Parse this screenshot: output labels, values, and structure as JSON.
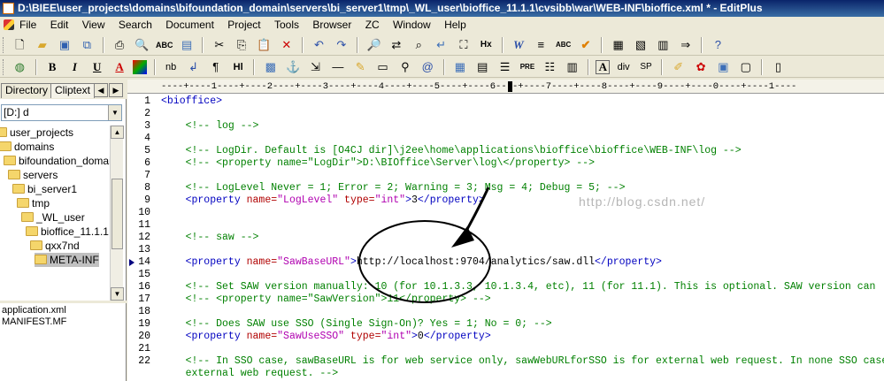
{
  "window": {
    "title": "D:\\BIEE\\user_projects\\domains\\bifoundation_domain\\servers\\bi_server1\\tmp\\_WL_user\\bioffice_11.1.1\\cvsibb\\war\\WEB-INF\\bioffice.xml * - EditPlus"
  },
  "menu": [
    "File",
    "Edit",
    "View",
    "Search",
    "Document",
    "Project",
    "Tools",
    "Browser",
    "ZC",
    "Window",
    "Help"
  ],
  "toolbar2_text": {
    "nb": "nb",
    "bold": "B",
    "italic": "I",
    "underline": "U",
    "font": "A",
    "para": "¶",
    "hi": "Hl",
    "pre": "PRE",
    "a": "A",
    "div": "div",
    "sp": "SP"
  },
  "left_panel": {
    "tabs": [
      "Directory",
      "Cliptext"
    ],
    "drive": "[D:] d",
    "tree": [
      {
        "label": "user_projects",
        "indent": 0
      },
      {
        "label": "domains",
        "indent": 1
      },
      {
        "label": "bifoundation_domain",
        "indent": 2
      },
      {
        "label": "servers",
        "indent": 3
      },
      {
        "label": "bi_server1",
        "indent": 4
      },
      {
        "label": "tmp",
        "indent": 5
      },
      {
        "label": "_WL_user",
        "indent": 6
      },
      {
        "label": "bioffice_11.1.1",
        "indent": 7
      },
      {
        "label": "qxx7nd",
        "indent": 8
      },
      {
        "label": "META-INF",
        "indent": 9,
        "selected": true
      }
    ],
    "files": [
      "application.xml",
      "MANIFEST.MF"
    ]
  },
  "editor": {
    "ruler": "----+----1----+----2----+----3----+----4----+----5----+----6----+----7----+----8----+----9----+----0----+----1----",
    "current_line": 14,
    "lines": [
      {
        "n": "1",
        "tokens": [
          {
            "t": "<bioffice>",
            "c": "tag"
          }
        ]
      },
      {
        "n": "2",
        "tokens": []
      },
      {
        "n": "3",
        "tokens": [
          {
            "t": "    <!-- log -->",
            "c": "cmt"
          }
        ]
      },
      {
        "n": "4",
        "tokens": []
      },
      {
        "n": "5",
        "tokens": [
          {
            "t": "    <!-- LogDir. Default is [O4CJ dir]\\j2ee\\home\\applications\\bioffice\\bioffice\\WEB-INF\\log -->",
            "c": "cmt"
          }
        ]
      },
      {
        "n": "6",
        "tokens": [
          {
            "t": "    <!-- <property name=\"LogDir\">D:\\BIOffice\\Server\\log\\</property> -->",
            "c": "cmt"
          }
        ]
      },
      {
        "n": "7",
        "tokens": []
      },
      {
        "n": "8",
        "tokens": [
          {
            "t": "    <!-- LogLevel Never = 1; Error = 2; Warning = 3; Msg = 4; Debug = 5; -->",
            "c": "cmt"
          }
        ]
      },
      {
        "n": "9",
        "tokens": [
          {
            "t": "    <property ",
            "c": "tag"
          },
          {
            "t": "name=",
            "c": "attr"
          },
          {
            "t": "\"LogLevel\"",
            "c": "str"
          },
          {
            "t": " type=",
            "c": "attr"
          },
          {
            "t": "\"int\"",
            "c": "str"
          },
          {
            "t": ">",
            "c": "tag"
          },
          {
            "t": "3",
            "c": "txt"
          },
          {
            "t": "</property>",
            "c": "tag"
          }
        ]
      },
      {
        "n": "10",
        "tokens": []
      },
      {
        "n": "11",
        "tokens": []
      },
      {
        "n": "12",
        "tokens": [
          {
            "t": "    <!-- saw -->",
            "c": "cmt"
          }
        ]
      },
      {
        "n": "13",
        "tokens": []
      },
      {
        "n": "14",
        "tokens": [
          {
            "t": "    <property ",
            "c": "tag"
          },
          {
            "t": "name=",
            "c": "attr"
          },
          {
            "t": "\"SawBaseURL\"",
            "c": "str"
          },
          {
            "t": ">",
            "c": "tag"
          },
          {
            "t": "http://localhost:9704/analytics/saw.dll",
            "c": "txt"
          },
          {
            "t": "</property>",
            "c": "tag"
          }
        ]
      },
      {
        "n": "15",
        "tokens": []
      },
      {
        "n": "16",
        "tokens": [
          {
            "t": "    <!-- Set SAW version manually: 10 (for 10.1.3.3, 10.1.3.4, etc), 11 (for 11.1). This is optional. SAW version can",
            "c": "cmt"
          }
        ]
      },
      {
        "n": "17",
        "tokens": [
          {
            "t": "    <!-- <property name=\"SawVersion\">11</property> -->",
            "c": "cmt"
          }
        ]
      },
      {
        "n": "18",
        "tokens": []
      },
      {
        "n": "19",
        "tokens": [
          {
            "t": "    <!-- Does SAW use SSO (Single Sign-On)? Yes = 1; No = 0; -->",
            "c": "cmt"
          }
        ]
      },
      {
        "n": "20",
        "tokens": [
          {
            "t": "    <property ",
            "c": "tag"
          },
          {
            "t": "name=",
            "c": "attr"
          },
          {
            "t": "\"SawUseSSO\"",
            "c": "str"
          },
          {
            "t": " type=",
            "c": "attr"
          },
          {
            "t": "\"int\"",
            "c": "str"
          },
          {
            "t": ">",
            "c": "tag"
          },
          {
            "t": "0",
            "c": "txt"
          },
          {
            "t": "</property>",
            "c": "tag"
          }
        ]
      },
      {
        "n": "21",
        "tokens": []
      },
      {
        "n": "22",
        "tokens": [
          {
            "t": "    <!-- In SSO case, sawBaseURL is for web service only, sawWebURLforSSO is for external web request. In none SSO case",
            "c": "cmt"
          }
        ]
      },
      {
        "n": "",
        "tokens": [
          {
            "t": "    external web request. -->",
            "c": "cmt"
          }
        ]
      }
    ],
    "watermark": "http://blog.csdn.net/"
  }
}
